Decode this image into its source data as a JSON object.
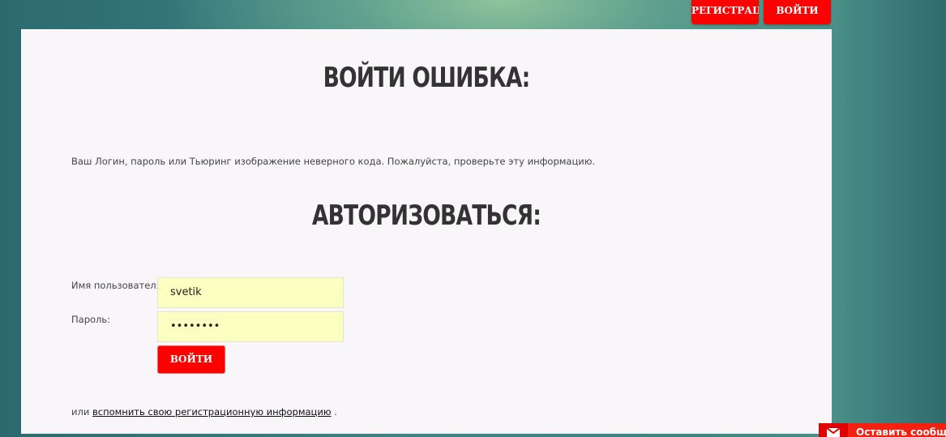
{
  "header": {
    "register_label": "РЕГИСТРАЦИЯ",
    "login_label": "ВОЙТИ"
  },
  "main": {
    "error_title": "ВОЙТИ ОШИБКА:",
    "error_message": "Ваш Логин, пароль или Тьюринг изображение неверного кода. Пожалуйста, проверьте эту информацию.",
    "auth_title": "АВТОРИЗОВАТЬСЯ:",
    "username_label": "Имя пользователя:",
    "username_value": "svetik",
    "password_label": "Пароль:",
    "password_value": "••••••••",
    "submit_label": "ВОЙТИ",
    "footer_prefix": "или",
    "footer_link": "вспомнить свою регистрационную информацию",
    "footer_suffix": "."
  },
  "widget": {
    "label": "Оставить сообщение",
    "icon": "mail-icon"
  }
}
